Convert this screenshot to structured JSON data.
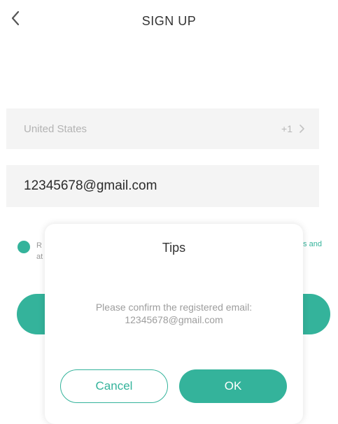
{
  "header": {
    "title": "SIGN UP",
    "back_icon": "chevron-left-icon"
  },
  "form": {
    "country_name": "United States",
    "country_code": "+1",
    "country_chevron_icon": "chevron-right-icon",
    "email_value": "12345678@gmail.com"
  },
  "agreement": {
    "checked": true,
    "text_left_fragment": "R\nat",
    "text_right_fragment": "ts and"
  },
  "dialog": {
    "title": "Tips",
    "message": "Please confirm the registered email: 12345678@gmail.com",
    "cancel_label": "Cancel",
    "ok_label": "OK"
  },
  "colors": {
    "accent": "#34b39b",
    "field_bg": "#f4f4f4",
    "placeholder_text": "#b3b3b3",
    "title_text": "#333333"
  }
}
